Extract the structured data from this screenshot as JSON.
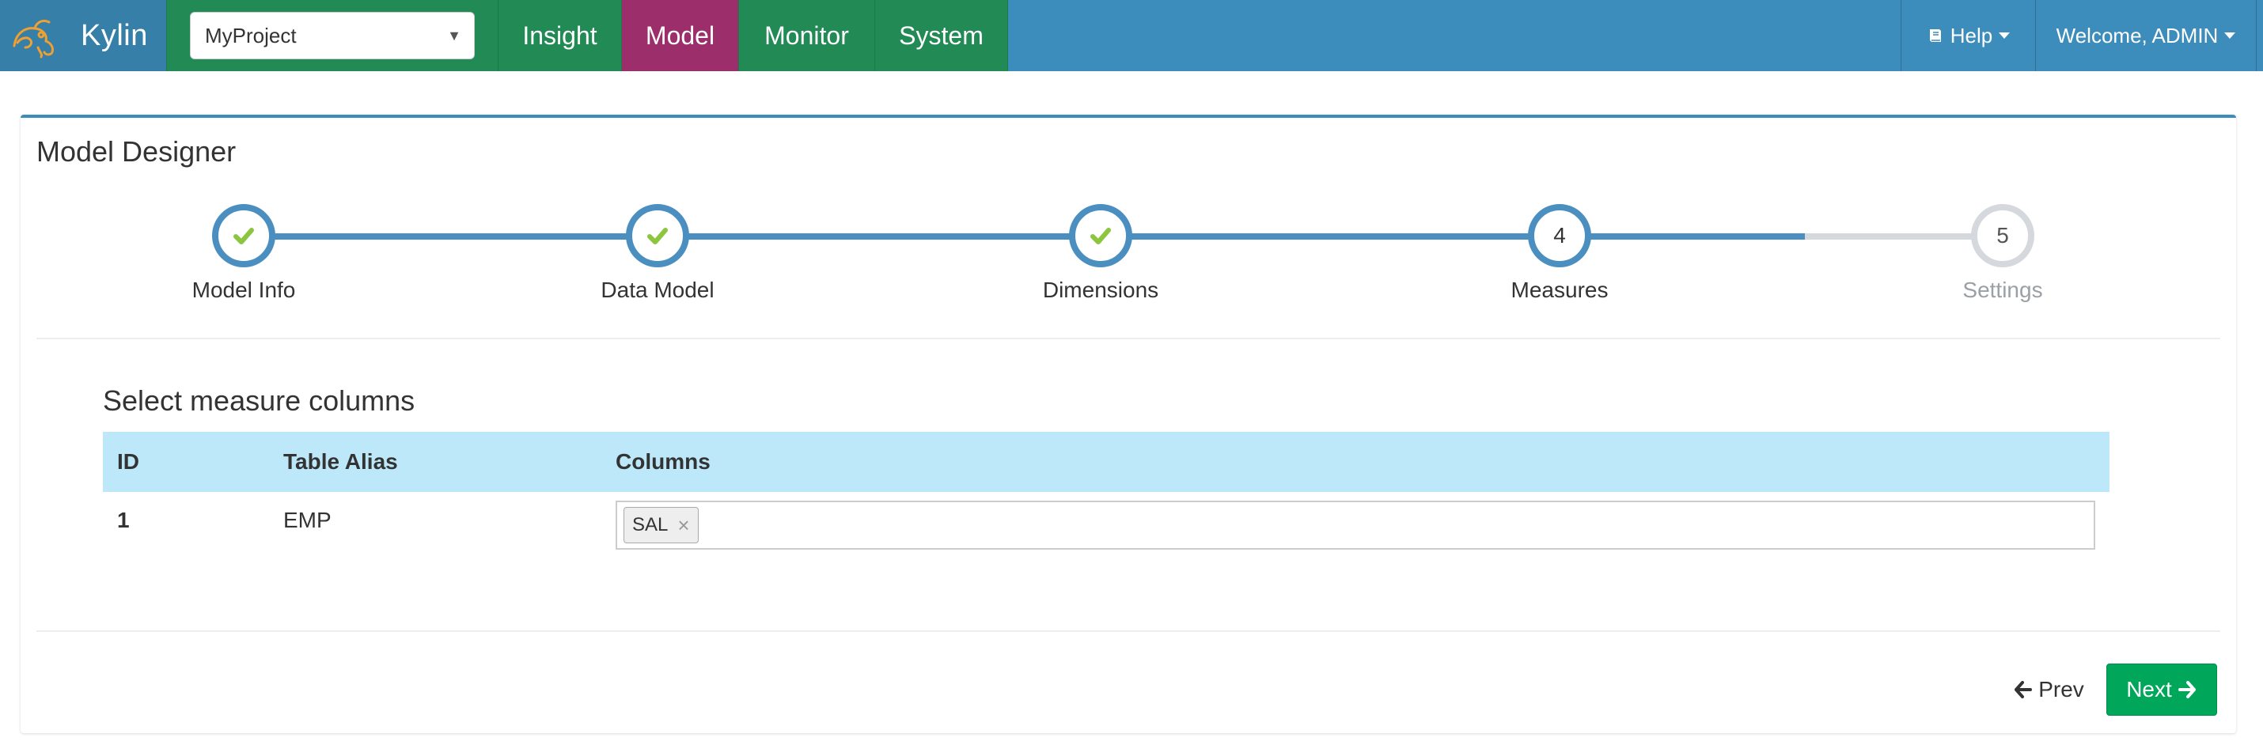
{
  "app": {
    "brand": "Kylin"
  },
  "project_selector": {
    "value": "MyProject"
  },
  "nav": {
    "tabs": [
      {
        "label": "Insight",
        "active": false
      },
      {
        "label": "Model",
        "active": true
      },
      {
        "label": "Monitor",
        "active": false
      },
      {
        "label": "System",
        "active": false
      }
    ],
    "help_label": "Help",
    "user_label": "Welcome, ADMIN"
  },
  "page": {
    "title": "Model Designer"
  },
  "wizard": {
    "steps": [
      {
        "label": "Model Info",
        "state": "done"
      },
      {
        "label": "Data Model",
        "state": "done"
      },
      {
        "label": "Dimensions",
        "state": "done"
      },
      {
        "label": "Measures",
        "state": "current",
        "number": "4"
      },
      {
        "label": "Settings",
        "state": "todo",
        "number": "5"
      }
    ]
  },
  "measures": {
    "section_title": "Select measure columns",
    "headers": {
      "id": "ID",
      "alias": "Table Alias",
      "columns": "Columns"
    },
    "rows": [
      {
        "id": "1",
        "alias": "EMP",
        "columns": [
          "SAL"
        ]
      }
    ]
  },
  "footer": {
    "prev_label": "Prev",
    "next_label": "Next"
  },
  "colors": {
    "navbar": "#3c8dbc",
    "nav_tab": "#218a55",
    "nav_tab_active": "#9c2f6b",
    "step_done": "#4a8fc0",
    "step_todo": "#d5d8dc",
    "check": "#8cc63f",
    "table_header": "#bce8f9",
    "next_button": "#00a65a"
  },
  "icons": {
    "brand": "kylin-logo",
    "help": "book-icon",
    "step_done": "check-icon",
    "tag_remove": "close-icon",
    "prev": "arrow-left-icon",
    "next": "arrow-right-icon"
  }
}
